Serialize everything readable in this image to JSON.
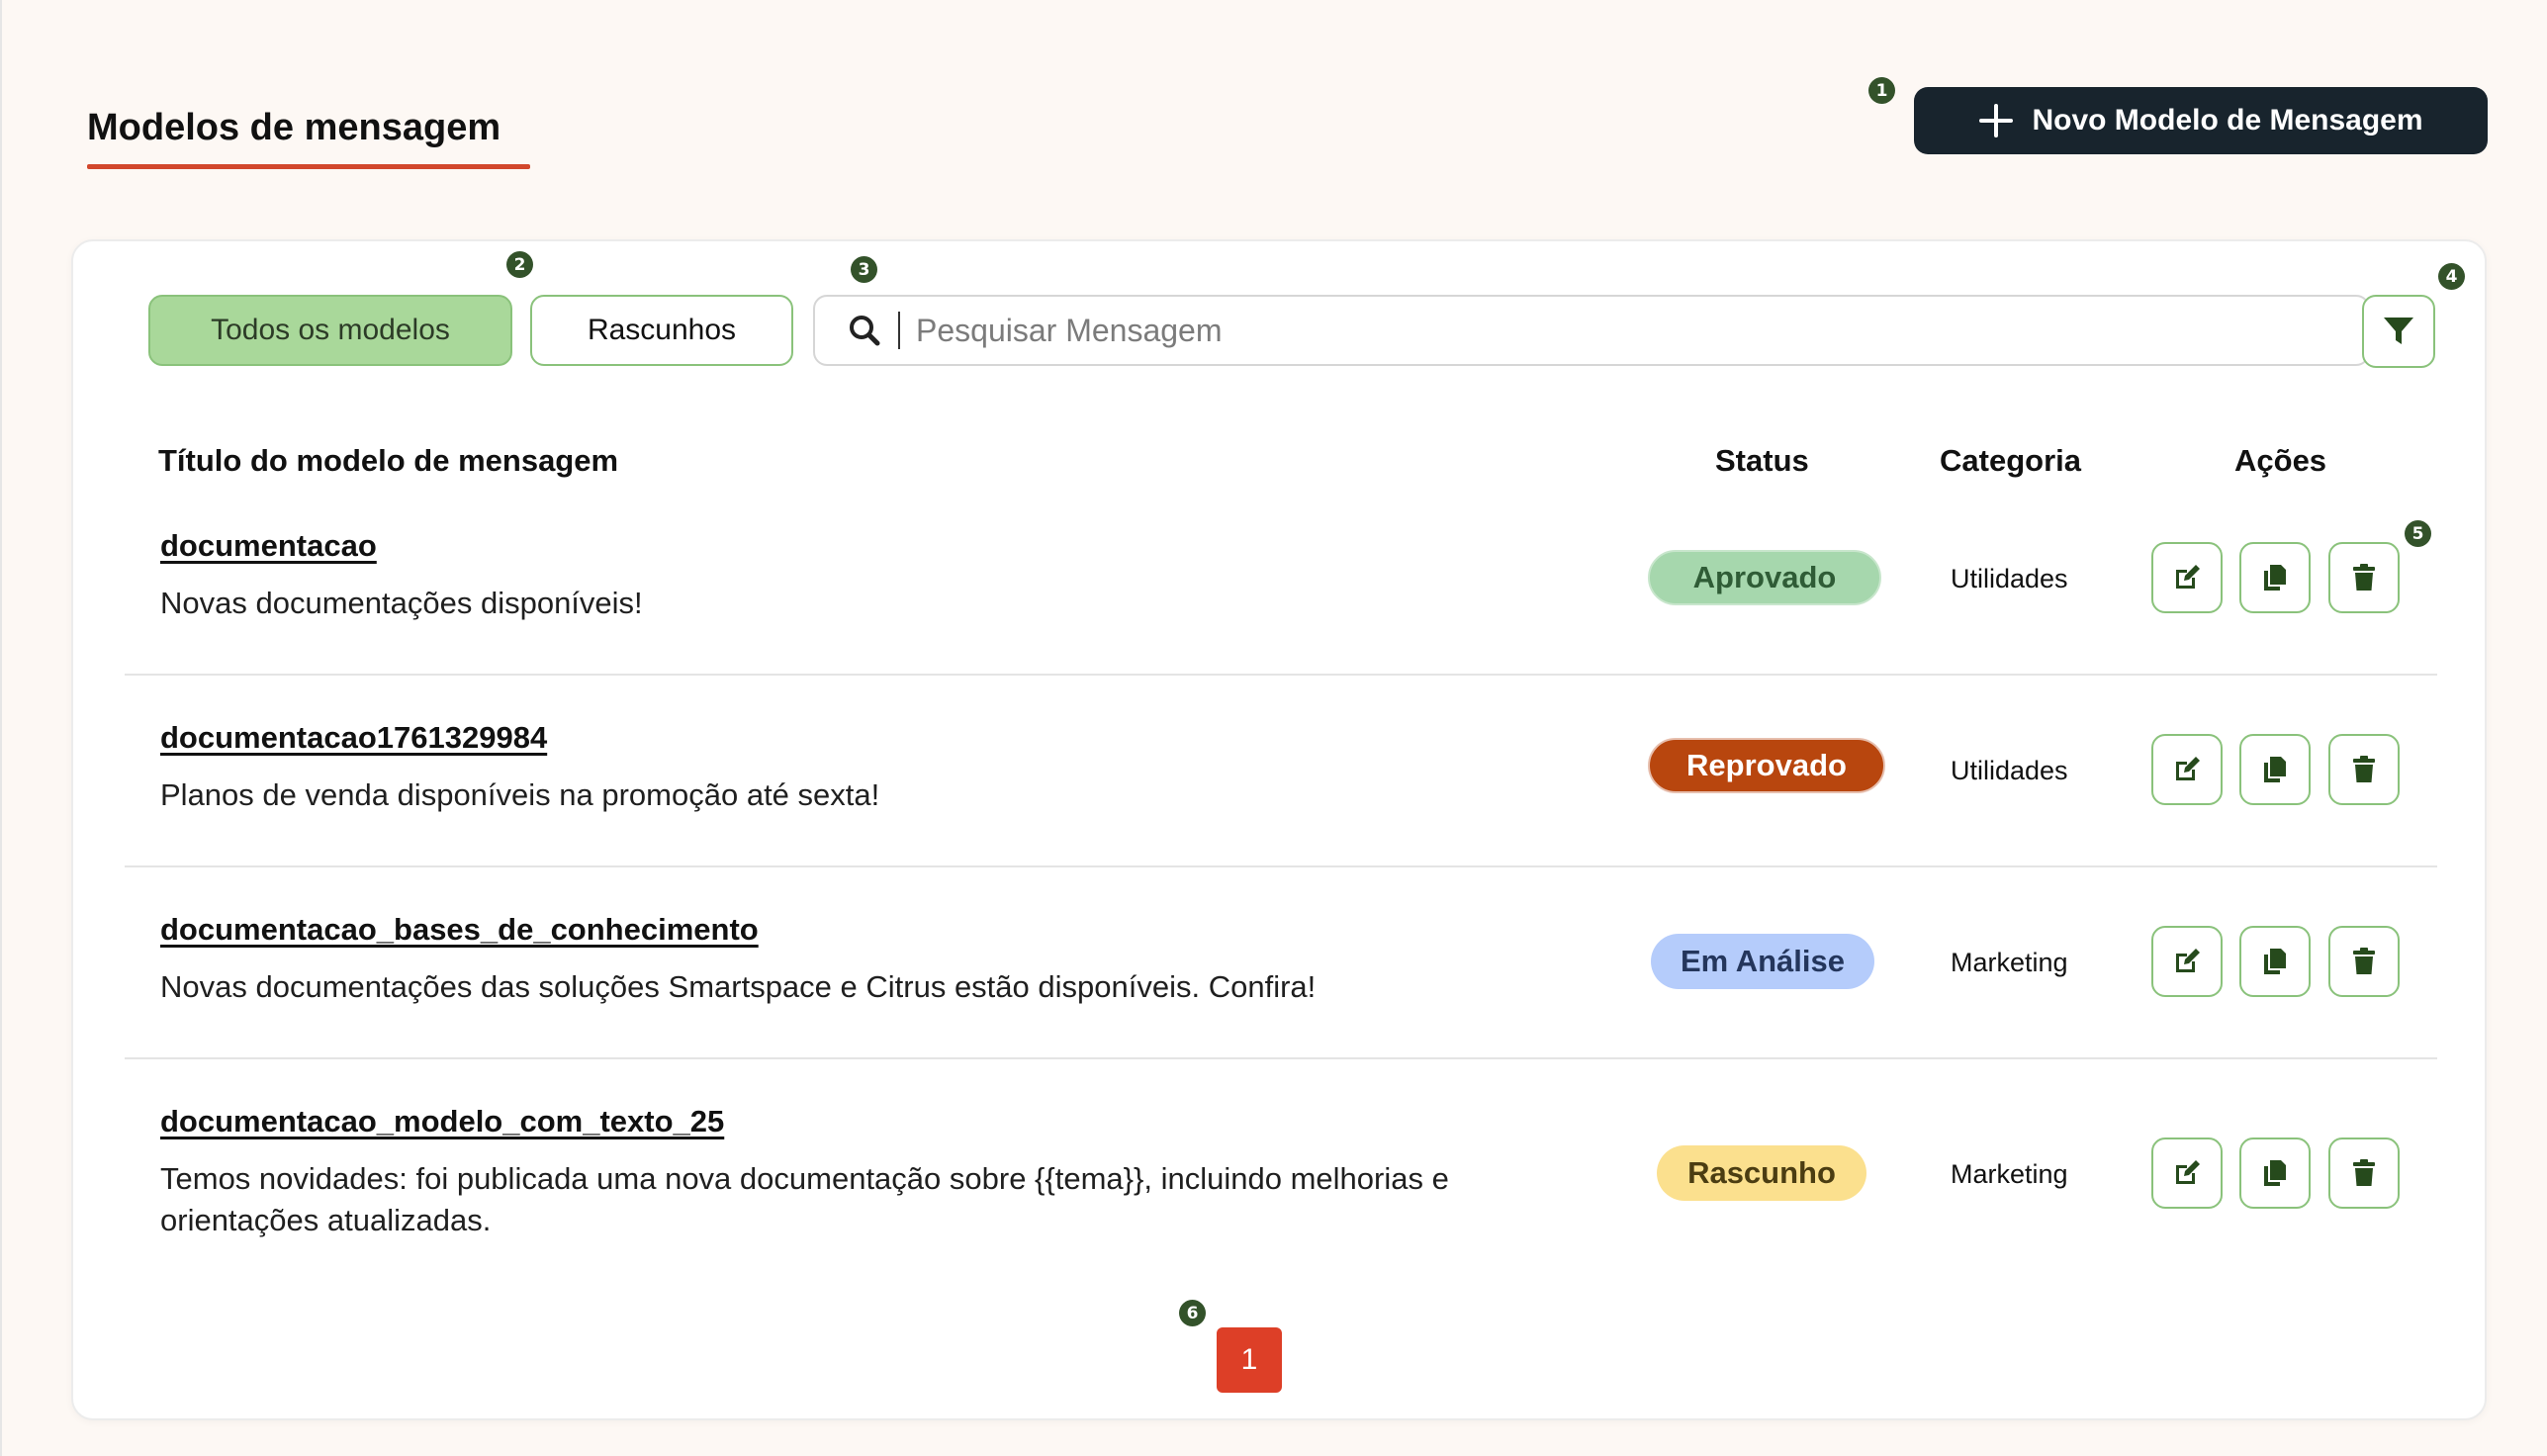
{
  "header": {
    "title": "Modelos de mensagem",
    "new_button_label": "Novo Modelo de Mensagem",
    "new_button_icon": "plus-icon"
  },
  "markers": [
    "1",
    "2",
    "3",
    "4",
    "5",
    "6"
  ],
  "toolbar": {
    "tabs": [
      {
        "label": "Todos os modelos",
        "active": true
      },
      {
        "label": "Rascunhos",
        "active": false
      }
    ],
    "search": {
      "placeholder": "Pesquisar Mensagem",
      "value": "",
      "icon": "search-icon"
    },
    "filter_icon": "filter-icon"
  },
  "table": {
    "columns": [
      "Título do modelo de mensagem",
      "Status",
      "Categoria",
      "Ações"
    ],
    "rows": [
      {
        "name": "documentacao",
        "description": "Novas documentações disponíveis!",
        "status": "Aprovado",
        "category": "Utilidades"
      },
      {
        "name": "documentacao1761329984",
        "description": "Planos de venda disponíveis na promoção até sexta!",
        "status": "Reprovado",
        "category": "Utilidades"
      },
      {
        "name": "documentacao_bases_de_conhecimento",
        "description": "Novas documentações das soluções Smartspace e Citrus estão disponíveis. Confira!",
        "status": "Em Análise",
        "category": "Marketing"
      },
      {
        "name": "documentacao_modelo_com_texto_25",
        "description": "Temos novidades: foi publicada uma nova documentação sobre {{tema}}, incluindo melhorias e orientações atualizadas.",
        "status": "Rascunho",
        "category": "Marketing"
      }
    ],
    "action_icons": [
      "edit-icon",
      "copy-icon",
      "trash-icon"
    ]
  },
  "pagination": {
    "current_page": "1"
  },
  "colors": {
    "accent_green": "#8ac27b",
    "dark_button": "#18242d",
    "title_underline": "#d2472c",
    "pager": "#dd3f27",
    "status_aprovado": "#a6d7ad",
    "status_reprovado": "#b8460e",
    "status_analise": "#b5ccfb",
    "status_rascunho": "#fbe08e"
  }
}
